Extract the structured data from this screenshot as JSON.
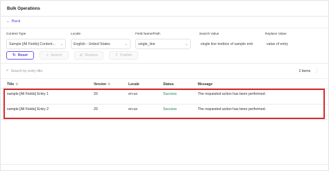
{
  "header": {
    "title": "Bulk Operations"
  },
  "back": {
    "label": "Back"
  },
  "filters": {
    "content_type": {
      "label": "Content Type",
      "value": "Sample [All Fields] Content..."
    },
    "locale": {
      "label": "Locale",
      "value": "English - United States"
    },
    "field": {
      "label": "Field Name/Path",
      "value": "single_line"
    },
    "search_value": {
      "label": "Search Value",
      "value": "single line textbox of sample entr"
    },
    "replace_value": {
      "label": "Replace Value",
      "value": "value of entry"
    }
  },
  "buttons": {
    "reset": "Reset",
    "search": "Search",
    "replace": "Replace",
    "publish": "Publish"
  },
  "table": {
    "search_placeholder": "Search by entry title",
    "count": "2 items",
    "columns": {
      "title": "Title",
      "version": "Version",
      "locale": "Locale",
      "status": "Status",
      "message": "Message"
    },
    "rows": [
      {
        "title": "sample [All Fields] Entry 1",
        "version": "20",
        "locale": "en-us",
        "status": "Success",
        "message": "The requested action has been performed."
      },
      {
        "title": "sample [All Fields] Entry 2",
        "version": "20",
        "locale": "en-us",
        "status": "Success",
        "message": "The requested action has been performed."
      }
    ]
  },
  "colors": {
    "accent": "#5b3fd6",
    "success": "#14874a",
    "highlight": "#d62b2b"
  }
}
